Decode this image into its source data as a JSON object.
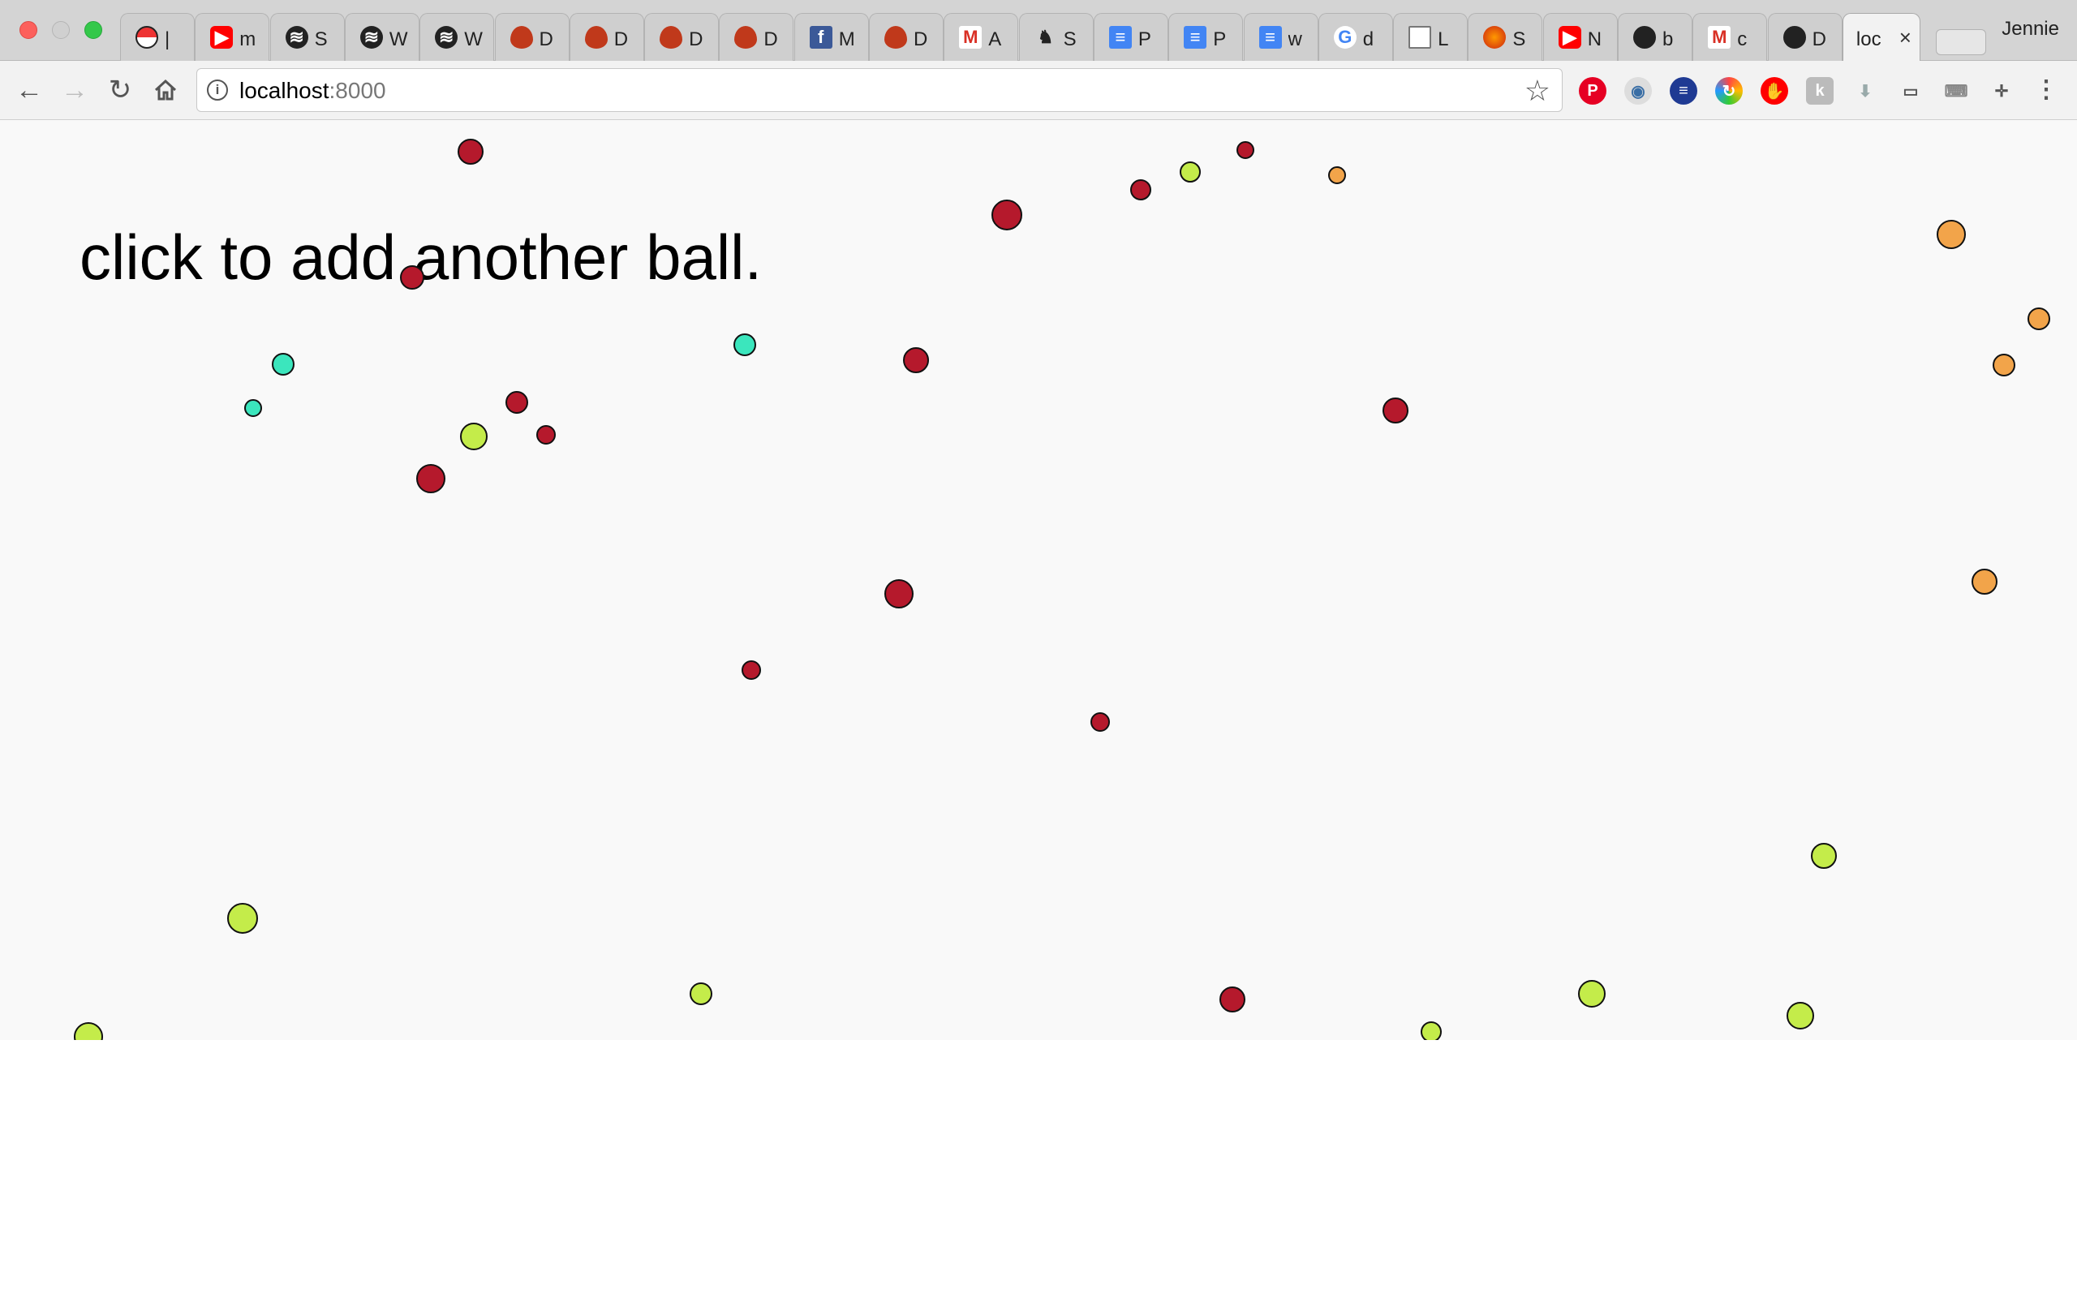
{
  "browser": {
    "profile_name": "Jennie",
    "address": {
      "host": "localhost",
      "port": ":8000"
    },
    "tabs": [
      {
        "title": "|",
        "icon": "pokeball-icon"
      },
      {
        "title": "m",
        "icon": "youtube-icon"
      },
      {
        "title": "S",
        "icon": "spotify-icon"
      },
      {
        "title": "W",
        "icon": "spotify-icon"
      },
      {
        "title": "W",
        "icon": "spotify-icon"
      },
      {
        "title": "D",
        "icon": "red-egg-icon"
      },
      {
        "title": "D",
        "icon": "red-egg-icon"
      },
      {
        "title": "D",
        "icon": "red-egg-icon"
      },
      {
        "title": "D",
        "icon": "red-egg-icon"
      },
      {
        "title": "M",
        "icon": "facebook-icon"
      },
      {
        "title": "D",
        "icon": "red-egg-icon"
      },
      {
        "title": "A",
        "icon": "gmail-icon"
      },
      {
        "title": "S",
        "icon": "crest-icon"
      },
      {
        "title": "P",
        "icon": "google-docs-icon"
      },
      {
        "title": "P",
        "icon": "google-docs-icon"
      },
      {
        "title": "w",
        "icon": "google-docs-icon"
      },
      {
        "title": "d",
        "icon": "google-icon"
      },
      {
        "title": "L",
        "icon": "document-icon"
      },
      {
        "title": "S",
        "icon": "mushroom-icon"
      },
      {
        "title": "N",
        "icon": "youtube-icon"
      },
      {
        "title": "b",
        "icon": "github-icon"
      },
      {
        "title": "c",
        "icon": "gmail-icon"
      },
      {
        "title": "D",
        "icon": "github-icon"
      },
      {
        "title": "loc",
        "icon": "none",
        "active": true
      }
    ],
    "extensions": [
      "pinterest-icon",
      "eye-icon",
      "flag-icon",
      "refresh-circle-icon",
      "adblock-icon",
      "grammarly-icon",
      "download-arrow-icon",
      "cast-icon",
      "keyboard-icon",
      "crosshair-icon"
    ]
  },
  "page": {
    "headline": "click to add another ball."
  },
  "colors": {
    "red": "#b5192c",
    "lime": "#c4ec4a",
    "aqua": "#3be6bd",
    "orange": "#f2a44a",
    "page_bg": "#f9f9f9",
    "ball_stroke": "#111111"
  }
}
